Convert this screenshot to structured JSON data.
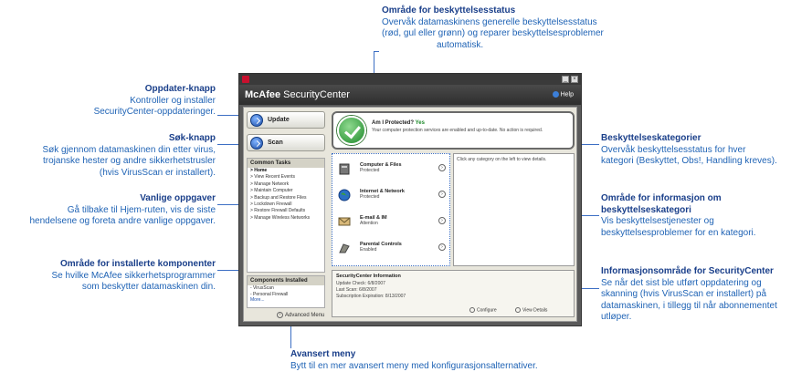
{
  "annotations": {
    "protection_status": {
      "title": "Område for beskyttelsesstatus",
      "lines": [
        "Overvåk datamaskinens generelle beskyttelsesstatus",
        "(rød, gul eller grønn) og reparer beskyttelsesproblemer",
        "automatisk."
      ]
    },
    "update_button": {
      "title": "Oppdater-knapp",
      "lines": [
        "Kontroller og installer",
        "SecurityCenter-oppdateringer."
      ]
    },
    "scan_button": {
      "title": "Søk-knapp",
      "lines": [
        "Søk gjennom datamaskinen din etter virus,",
        "trojanske hester og andre sikkerhetstrusler",
        "(hvis VirusScan er installert)."
      ]
    },
    "common_tasks": {
      "title": "Vanlige oppgaver",
      "lines": [
        "Gå tilbake til Hjem-ruten, vis de siste",
        "hendelsene og foreta andre vanlige oppgaver."
      ]
    },
    "installed_components": {
      "title": "Område for installerte komponenter",
      "lines": [
        "Se hvilke McAfee sikkerhetsprogrammer",
        "som beskytter datamaskinen din."
      ]
    },
    "protection_categories": {
      "title": "Beskyttelseskategorier",
      "lines": [
        "Overvåk beskyttelsesstatus for hver",
        "kategori (Beskyttet, Obs!, Handling kreves)."
      ]
    },
    "category_info": {
      "title_lines": [
        "Område for informasjon om",
        "beskyttelseskategori"
      ],
      "lines": [
        "Vis beskyttelsestjenester og",
        "beskyttelsesproblemer for en kategori."
      ]
    },
    "securitycenter_info": {
      "title": "Informasjonsområde for SecurityCenter",
      "lines": [
        "Se når det sist ble utført oppdatering og",
        "skanning (hvis VirusScan er installert) på",
        "datamaskinen, i tillegg til når abonnementet",
        "utløper."
      ]
    },
    "advanced_menu": {
      "title": "Avansert meny",
      "lines": [
        "Bytt til en mer avansert meny med konfigurasjonsalternativer."
      ]
    }
  },
  "window": {
    "brand_bold": "McAfee",
    "brand_rest": " SecurityCenter",
    "help": "Help",
    "update": "Update",
    "scan": "Scan",
    "status_question": "Am I Protected?",
    "status_answer": "Yes",
    "status_desc": "Your computer protection services are enabled and up-to-date. No action is required.",
    "tasks_header": "Common Tasks",
    "tasks": [
      "> Home",
      "> View Recent Events",
      "> Manage Network",
      "> Maintain Computer",
      "> Backup and Restore Files",
      "> Lockdown Firewall",
      "> Restore Firewall Defaults",
      "> Manage Wireless Networks"
    ],
    "components_header": "Components Installed",
    "components": [
      "- VirusScan",
      "- Personal Firewall",
      "More..."
    ],
    "advanced_menu": "Advanced Menu",
    "categories": [
      {
        "name": "Computer & Files",
        "status": "Protected"
      },
      {
        "name": "Internet & Network",
        "status": "Protected"
      },
      {
        "name": "E-mail & IM",
        "status": "Attention"
      },
      {
        "name": "Parental Controls",
        "status": "Enabled"
      }
    ],
    "detail_hint": "Click any category on the left to view details.",
    "info_header": "SecurityCenter Information",
    "info_lines": [
      "Update Check: 6/8/2007",
      "Last Scan: 6/8/2007",
      "Subscription Expiration: 8/13/2007"
    ],
    "configure": "Configure",
    "view_details": "View Details"
  }
}
